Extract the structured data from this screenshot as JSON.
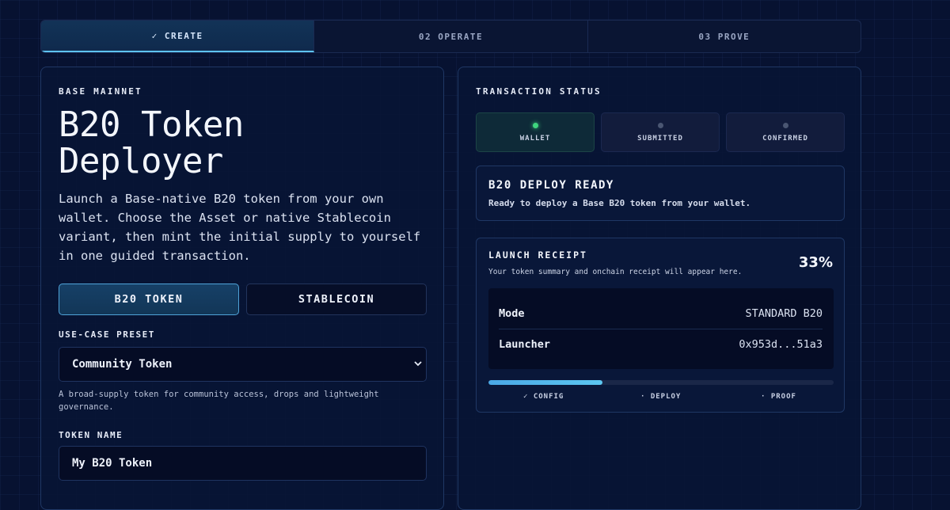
{
  "steps": [
    {
      "label": "✓ CREATE"
    },
    {
      "label": "02 OPERATE"
    },
    {
      "label": "03 PROVE"
    }
  ],
  "form": {
    "network": "BASE MAINNET",
    "title_line1": "B20 Token",
    "title_line2": "Deployer",
    "description": "Launch a Base-native B20 token from your own wallet. Choose the Asset or native Stablecoin variant, then mint the initial supply to yourself in one guided transaction.",
    "variants": [
      {
        "label": "B20 TOKEN"
      },
      {
        "label": "STABLECOIN"
      }
    ],
    "preset_label": "USE-CASE PRESET",
    "preset_value": "Community Token",
    "preset_help": "A broad-supply token for community access, drops and lightweight governance.",
    "token_name_label": "TOKEN NAME",
    "token_name_value": "My B20 Token"
  },
  "status": {
    "title": "TRANSACTION STATUS",
    "chips": [
      {
        "label": "WALLET"
      },
      {
        "label": "SUBMITTED"
      },
      {
        "label": "CONFIRMED"
      }
    ],
    "active_color": "#3fd67e",
    "ready_title": "B20 DEPLOY READY",
    "ready_sub": "Ready to deploy a Base B20 token from your wallet."
  },
  "receipt": {
    "title": "LAUNCH RECEIPT",
    "subtitle": "Your token summary and onchain receipt will appear here.",
    "percent": "33%",
    "progress_value": 0.33,
    "rows": [
      {
        "key": "Mode",
        "value": "STANDARD B20"
      },
      {
        "key": "Launcher",
        "value": "0x953d...51a3"
      }
    ],
    "milestones": [
      {
        "label": "✓ CONFIG"
      },
      {
        "label": "· DEPLOY"
      },
      {
        "label": "· PROOF"
      }
    ]
  }
}
